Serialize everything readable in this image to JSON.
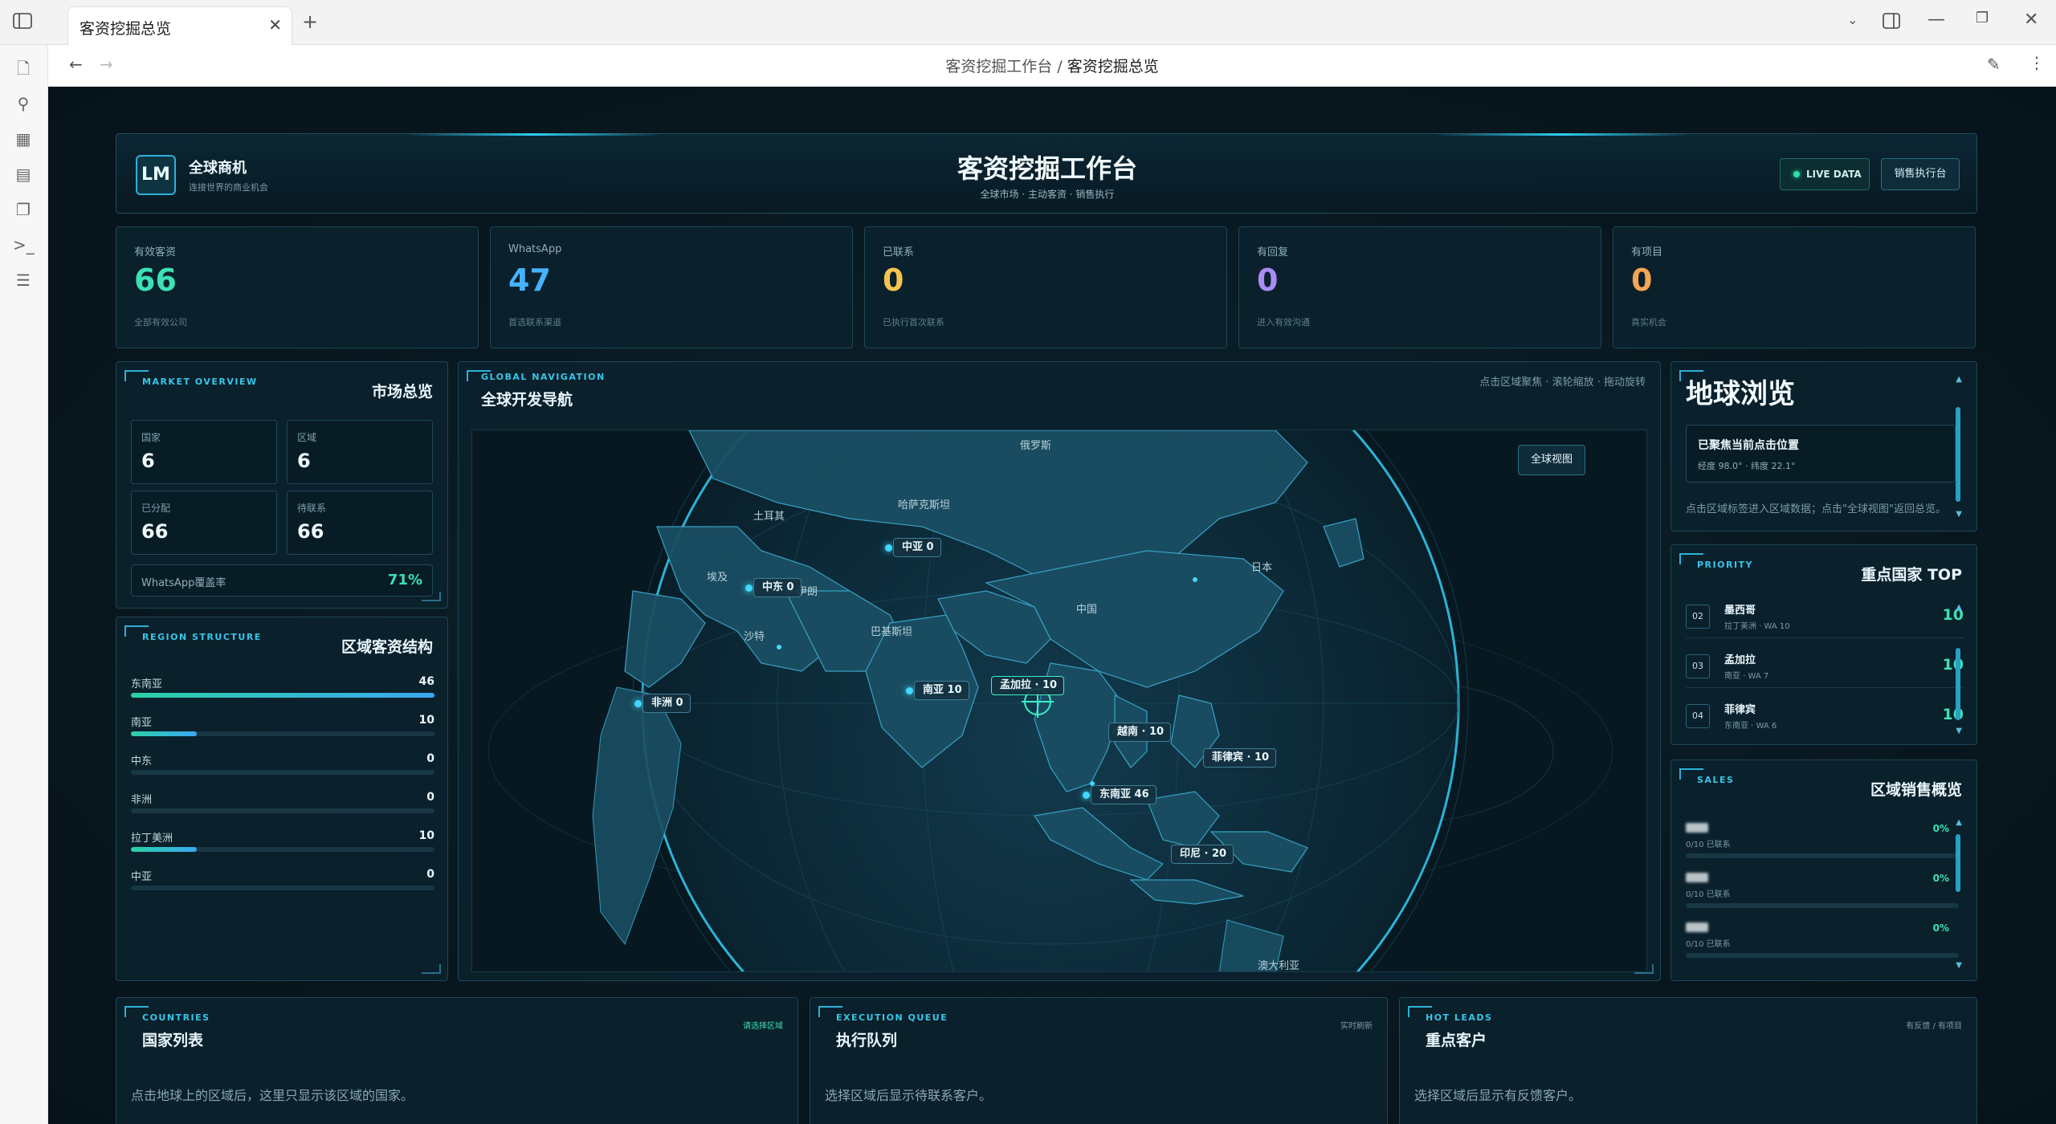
{
  "browser": {
    "tab_title": "客资挖掘总览",
    "breadcrumb_parent": "客资挖掘工作台",
    "breadcrumb_sep": " / ",
    "breadcrumb_current": "客资挖掘总览"
  },
  "header": {
    "logo_text": "LM",
    "brand_name": "全球商机",
    "brand_sub": "连接世界的商业机会",
    "title": "客资挖掘工作台",
    "subtitle": "全球市场 · 主动客资 · 销售执行",
    "live_label": "LIVE DATA",
    "exec_button": "销售执行台"
  },
  "stats": [
    {
      "label": "有效客资",
      "value": "66",
      "sub": "全部有效公司",
      "color": "#3de0b4"
    },
    {
      "label": "WhatsApp",
      "value": "47",
      "sub": "首选联系渠道",
      "color": "#45b3ff"
    },
    {
      "label": "已联系",
      "value": "0",
      "sub": "已执行首次联系",
      "color": "#f5c350"
    },
    {
      "label": "有回复",
      "value": "0",
      "sub": "进入有效沟通",
      "color": "#a98cf5"
    },
    {
      "label": "有项目",
      "value": "0",
      "sub": "真实机会",
      "color": "#f5a653"
    }
  ],
  "market": {
    "en": "MARKET OVERVIEW",
    "title": "市场总览",
    "cells": [
      {
        "label": "国家",
        "value": "6"
      },
      {
        "label": "区域",
        "value": "6"
      },
      {
        "label": "已分配",
        "value": "66"
      },
      {
        "label": "待联系",
        "value": "66"
      }
    ],
    "coverage_label": "WhatsApp覆盖率",
    "coverage_value": "71%"
  },
  "regions": {
    "en": "REGION STRUCTURE",
    "title": "区域客资结构",
    "max": 46,
    "rows": [
      {
        "name": "东南亚",
        "count": 46
      },
      {
        "name": "南亚",
        "count": 10
      },
      {
        "name": "中东",
        "count": 0
      },
      {
        "name": "非洲",
        "count": 0
      },
      {
        "name": "拉丁美洲",
        "count": 10
      },
      {
        "name": "中亚",
        "count": 0
      }
    ]
  },
  "globe": {
    "en": "GLOBAL NAVIGATION",
    "title": "全球开发导航",
    "hint": "点击区域聚焦 · 滚轮缩放 · 拖动旋转",
    "full_view_button": "全球视图",
    "labels": [
      "俄罗斯",
      "土耳其",
      "哈萨克斯坦",
      "埃及",
      "伊朗",
      "沙特",
      "巴基斯坦",
      "中国",
      "日本",
      "澳大利亚"
    ],
    "pins": [
      "中亚 0",
      "中东 0",
      "非洲 0",
      "南亚 10",
      "孟加拉 · 10",
      "越南 · 10",
      "菲律宾 · 10",
      "东南亚 46",
      "印尼 · 20"
    ]
  },
  "earth_browse": {
    "title": "地球浏览",
    "focus_title": "已聚焦当前点击位置",
    "focus_coords": "经度 98.0° · 纬度 22.1°",
    "hint": "点击区域标签进入区域数据；点击\"全球视图\"返回总览。"
  },
  "priority": {
    "en": "PRIORITY",
    "title": "重点国家 TOP",
    "rows": [
      {
        "rank": "02",
        "name": "墨西哥",
        "sub": "拉丁美洲 · WA 10",
        "score": "10"
      },
      {
        "rank": "03",
        "name": "孟加拉",
        "sub": "南亚 · WA 7",
        "score": "10"
      },
      {
        "rank": "04",
        "name": "菲律宾",
        "sub": "东南亚 · WA 6",
        "score": "10"
      }
    ]
  },
  "sales": {
    "en": "SALES",
    "title": "区域销售概览",
    "rows": [
      {
        "sub": "0/10 已联系",
        "pct": "0%",
        "progress": 0
      },
      {
        "sub": "0/10 已联系",
        "pct": "0%",
        "progress": 0
      },
      {
        "sub": "0/10 已联系",
        "pct": "0%",
        "progress": 0
      }
    ]
  },
  "countries": {
    "en": "COUNTRIES",
    "title": "国家列表",
    "tag": "请选择区域",
    "hint": "点击地球上的区域后，这里只显示该区域的国家。"
  },
  "queue": {
    "en": "EXECUTION QUEUE",
    "title": "执行队列",
    "tag": "实时刷新",
    "hint": "选择区域后显示待联系客户。"
  },
  "hotleads": {
    "en": "HOT LEADS",
    "title": "重点客户",
    "tag": "有反馈 / 有项目",
    "hint": "选择区域后显示有反馈客户。"
  }
}
